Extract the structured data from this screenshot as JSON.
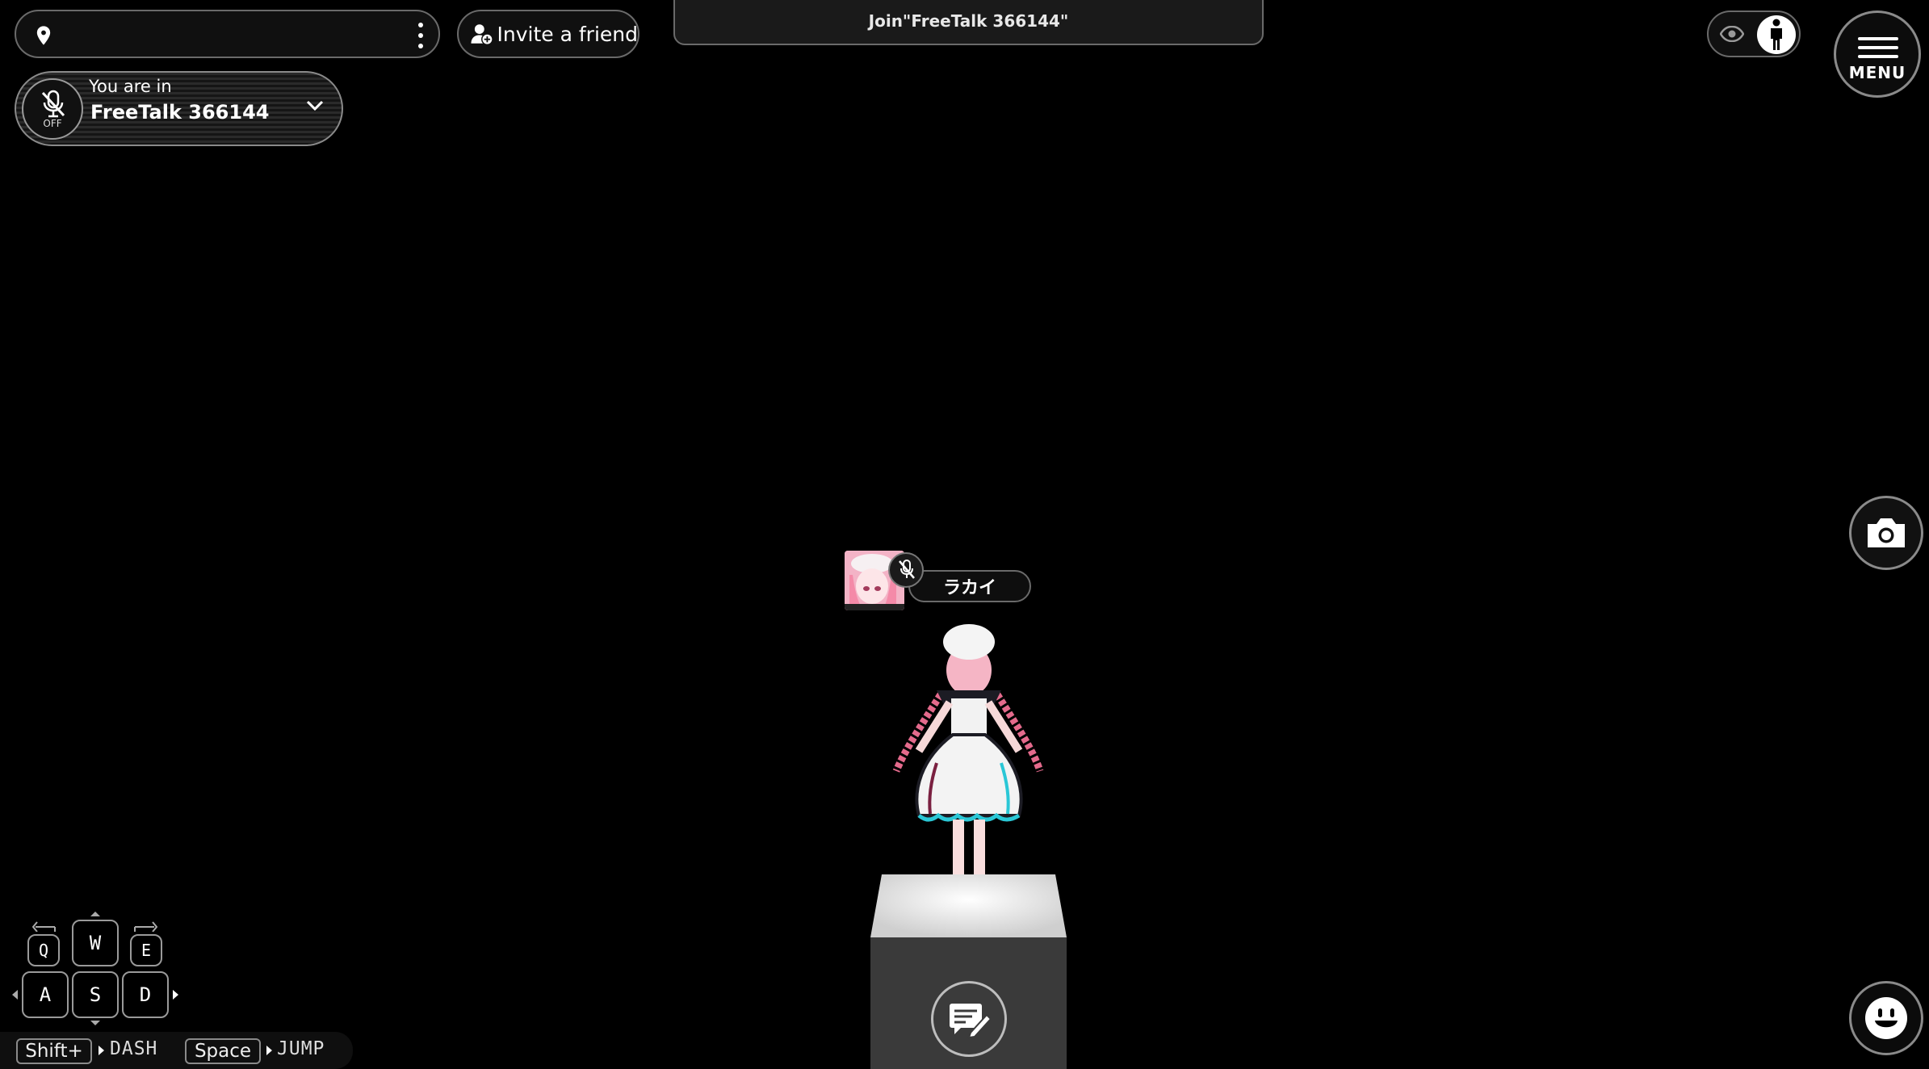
{
  "location_bar": {
    "text": ""
  },
  "invite": {
    "label": "Invite a friend"
  },
  "join_banner": {
    "text": "Join\"FreeTalk 366144\""
  },
  "room": {
    "prefix": "You are in",
    "name": "FreeTalk 366144",
    "mic_status": "OFF"
  },
  "menu": {
    "label": "MENU"
  },
  "player": {
    "name": "ラカイ"
  },
  "keys": {
    "q": "Q",
    "w": "W",
    "e": "E",
    "a": "A",
    "s": "S",
    "d": "D"
  },
  "hints": {
    "dash_key": "Shift+",
    "dash_label": "DASH",
    "jump_key": "Space",
    "jump_label": "JUMP"
  },
  "icons": [
    "location-pin-icon",
    "more-vertical-icon",
    "add-user-icon",
    "mic-off-icon",
    "chevron-down-icon",
    "eye-icon",
    "person-icon",
    "menu-icon",
    "camera-icon",
    "chat-edit-icon",
    "emoji-face-icon"
  ],
  "colors": {
    "background": "#000000",
    "border": "#6a6a6a",
    "pedestal_top": "#e6e6e6",
    "pedestal_side": "#3a3a3a"
  }
}
